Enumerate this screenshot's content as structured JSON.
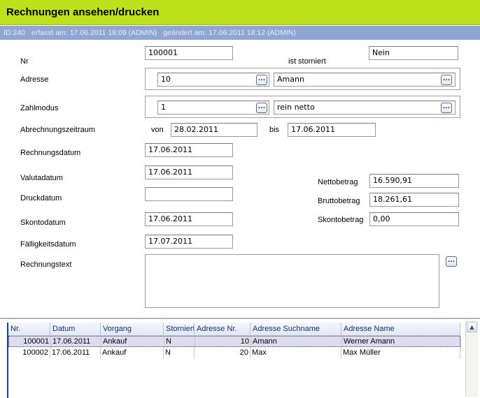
{
  "window": {
    "title": "Rechnungen ansehen/drucken"
  },
  "info": {
    "id": "ID:240",
    "created": "erfasst am: 17.06.2011 18:09 (ADMIN)",
    "changed": "geändert am: 17.06.2011 18:12 (ADMIN)"
  },
  "form": {
    "nr_label": "Nr",
    "nr_value": "100001",
    "storniert_label": "ist storniert",
    "storniert_value": "Nein",
    "adresse_label": "Adresse",
    "adresse_nr": "10",
    "adresse_name": "Amann",
    "zahlmodus_label": "Zahlmodus",
    "zahlmodus_nr": "1",
    "zahlmodus_name": "rein netto",
    "zeitraum_label": "Abrechnungszeitraum",
    "von_label": "von",
    "von_value": "28.02.2011",
    "bis_label": "bis",
    "bis_value": "17.06.2011",
    "rechnungsdatum_label": "Rechnungsdatum",
    "rechnungsdatum_value": "17.06.2011",
    "valutadatum_label": "Valutadatum",
    "valutadatum_value": "17.06.2011",
    "druckdatum_label": "Druckdatum",
    "druckdatum_value": "",
    "skontodatum_label": "Skontodatum",
    "skontodatum_value": "17.06.2011",
    "faelligkeit_label": "Fälligkeitsdatum",
    "faelligkeit_value": "17.07.2011",
    "rechnungstext_label": "Rechnungstext",
    "rechnungstext_value": "",
    "netto_label": "Nettobetrag",
    "netto_value": "16.590,91",
    "brutto_label": "Bruttobetrag",
    "brutto_value": "18.261,61",
    "skonto_label": "Skontobetrag",
    "skonto_value": "0,00",
    "lookup_glyph": "..."
  },
  "grid": {
    "columns": [
      "Nr.",
      "Datum",
      "Vorgang",
      "Storniert",
      "Adresse Nr.",
      "Adresse Suchname",
      "Adresse Name"
    ],
    "rows": [
      [
        "100001",
        "17.06.2011",
        "Ankauf",
        "N",
        "10",
        "Amann",
        "Werner Amann"
      ],
      [
        "100002",
        "17.06.2011",
        "Ankauf",
        "N",
        "20",
        "Max",
        "Max Müller"
      ]
    ],
    "scroll_up_glyph": "▲"
  }
}
